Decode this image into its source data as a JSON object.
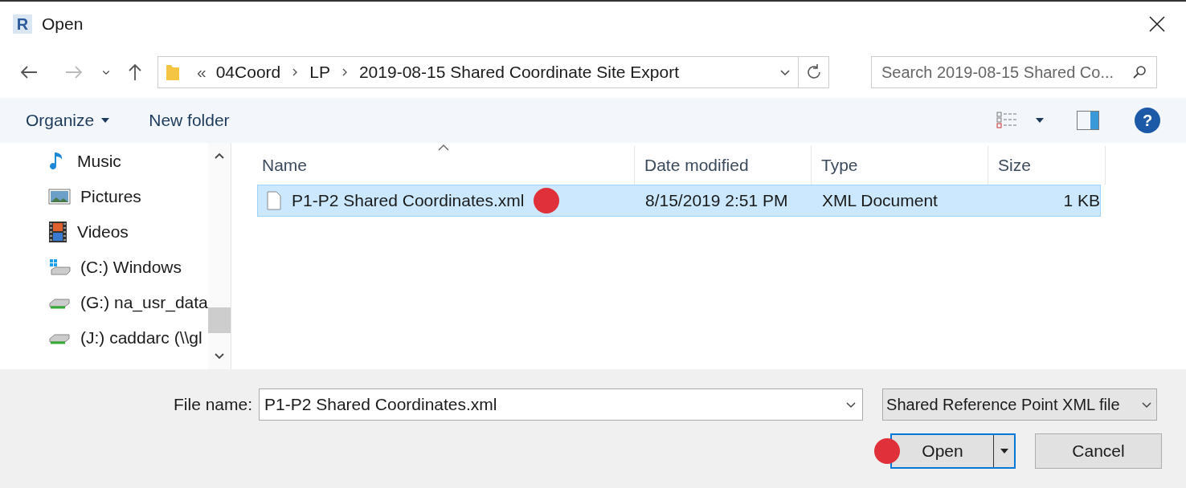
{
  "window": {
    "app_icon_letter": "R",
    "title": "Open"
  },
  "address_bar": {
    "overflow": "«",
    "path": [
      "04Coord",
      "LP",
      "2019-08-15 Shared Coordinate Site Export"
    ]
  },
  "search": {
    "placeholder": "Search 2019-08-15 Shared Co..."
  },
  "toolbar": {
    "organize": "Organize",
    "new_folder": "New folder",
    "help": "?"
  },
  "sidebar": {
    "items": [
      {
        "label": "Music",
        "kind": "music"
      },
      {
        "label": "Pictures",
        "kind": "pictures"
      },
      {
        "label": "Videos",
        "kind": "videos"
      },
      {
        "label": "(C:) Windows",
        "kind": "system-drive"
      },
      {
        "label": "(G:) na_usr_data",
        "kind": "network-drive"
      },
      {
        "label": "(J:) caddarc (\\\\gl",
        "kind": "network-drive"
      }
    ]
  },
  "table": {
    "columns": [
      "Name",
      "Date modified",
      "Type",
      "Size"
    ],
    "rows": [
      {
        "cells": [
          "P1-P2 Shared Coordinates.xml",
          "8/15/2019 2:51 PM",
          "XML Document",
          "1 KB"
        ],
        "selected": true
      }
    ]
  },
  "footer": {
    "file_name_label": "File name:",
    "file_name": "P1-P2 Shared Coordinates.xml",
    "file_type": "Shared Reference Point XML file",
    "open": "Open",
    "cancel": "Cancel"
  }
}
